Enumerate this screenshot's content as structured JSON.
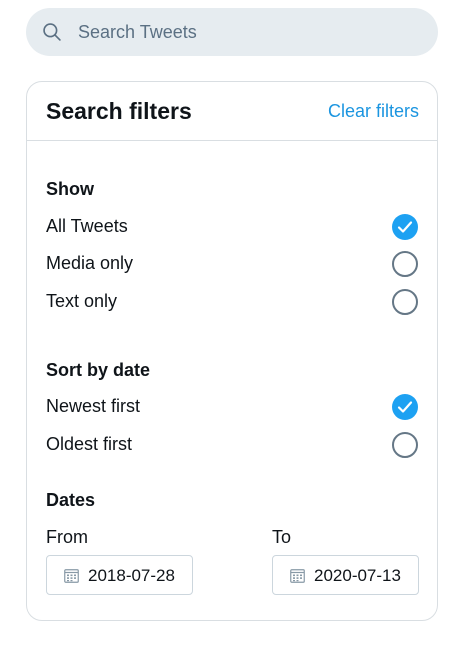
{
  "search": {
    "placeholder": "Search Tweets",
    "value": "",
    "icon": "search-icon"
  },
  "filters": {
    "title": "Search filters",
    "clear_label": "Clear filters",
    "show": {
      "title": "Show",
      "options": [
        {
          "label": "All Tweets",
          "selected": true
        },
        {
          "label": "Media only",
          "selected": false
        },
        {
          "label": "Text only",
          "selected": false
        }
      ]
    },
    "sort": {
      "title": "Sort by date",
      "options": [
        {
          "label": "Newest first",
          "selected": true
        },
        {
          "label": "Oldest first",
          "selected": false
        }
      ]
    },
    "dates": {
      "title": "Dates",
      "from_label": "From",
      "from_value": "2018-07-28",
      "to_label": "To",
      "to_value": "2020-07-13",
      "icon": "calendar-icon"
    }
  },
  "colors": {
    "accent": "#1da1f2",
    "link": "#1b95e0",
    "search_bg": "#e6ecf0",
    "border": "#d9dee2"
  }
}
